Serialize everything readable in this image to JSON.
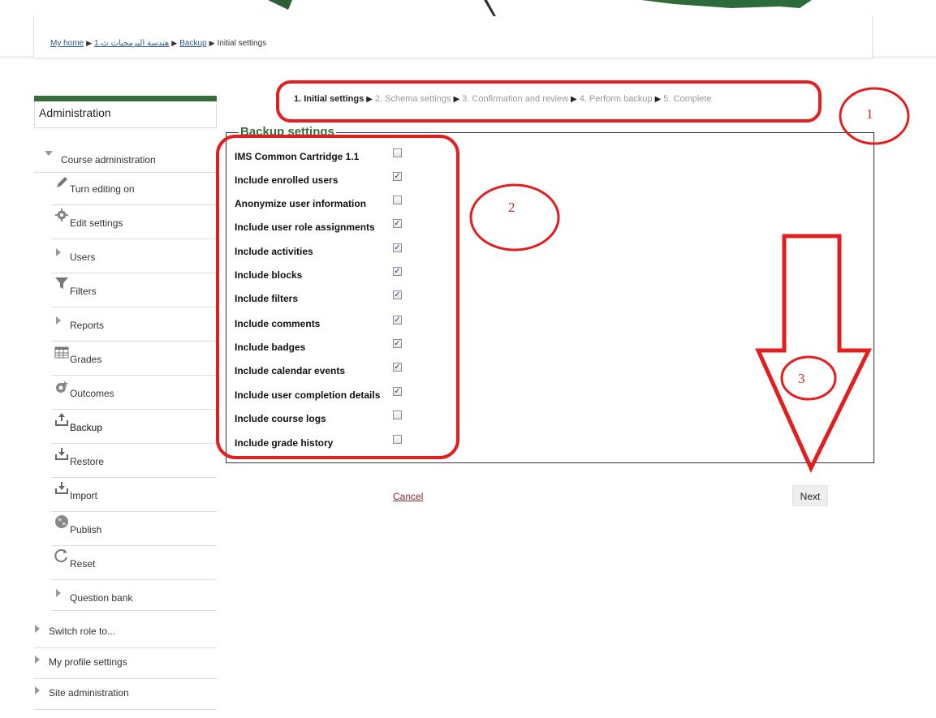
{
  "breadcrumb": {
    "items": [
      "My home",
      "هندسة البرمجيات ث.1",
      "Backup",
      "Initial settings"
    ],
    "separator": "▶"
  },
  "sidebar": {
    "title": "Administration",
    "section": "Course administration",
    "items": [
      {
        "label": "Turn editing on",
        "icon": "pencil-icon"
      },
      {
        "label": "Edit settings",
        "icon": "gear-icon"
      },
      {
        "label": "Users",
        "icon": "triangle-right-icon"
      },
      {
        "label": "Filters",
        "icon": "filter-icon"
      },
      {
        "label": "Reports",
        "icon": "triangle-right-icon"
      },
      {
        "label": "Grades",
        "icon": "grades-table-icon"
      },
      {
        "label": "Outcomes",
        "icon": "outcomes-icon"
      },
      {
        "label": "Backup",
        "icon": "backup-icon"
      },
      {
        "label": "Restore",
        "icon": "restore-icon"
      },
      {
        "label": "Import",
        "icon": "import-icon"
      },
      {
        "label": "Publish",
        "icon": "globe-icon"
      },
      {
        "label": "Reset",
        "icon": "reset-icon"
      },
      {
        "label": "Question bank",
        "icon": "triangle-right-icon"
      }
    ],
    "bottom": [
      "Switch role to...",
      "My profile settings",
      "Site administration"
    ]
  },
  "steps": {
    "items": [
      "1. Initial settings",
      "2. Schema settings",
      "3. Confirmation and review",
      "4. Perform backup",
      "5. Complete"
    ],
    "separator": "▶"
  },
  "settings": {
    "legend": "Backup settings",
    "items": [
      {
        "label": "IMS Common Cartridge 1.1",
        "checked": false
      },
      {
        "label": "Include enrolled users",
        "checked": true
      },
      {
        "label": "Anonymize user information",
        "checked": false
      },
      {
        "label": "Include user role assignments",
        "checked": true
      },
      {
        "label": "Include activities",
        "checked": true
      },
      {
        "label": "Include blocks",
        "checked": true
      },
      {
        "label": "Include filters",
        "checked": true
      },
      {
        "label": "Include comments",
        "checked": true
      },
      {
        "label": "Include badges",
        "checked": true
      },
      {
        "label": "Include calendar events",
        "checked": true
      },
      {
        "label": "Include user completion details",
        "checked": true
      },
      {
        "label": "Include course logs",
        "checked": false
      },
      {
        "label": "Include grade history",
        "checked": false
      }
    ]
  },
  "actions": {
    "cancel": "Cancel",
    "next": "Next"
  },
  "annotations": {
    "one": "1",
    "two": "2",
    "three": "3",
    "color": "#e31e1e"
  },
  "colors": {
    "accent": "#386c3b",
    "annotation": "#e31e1e"
  }
}
